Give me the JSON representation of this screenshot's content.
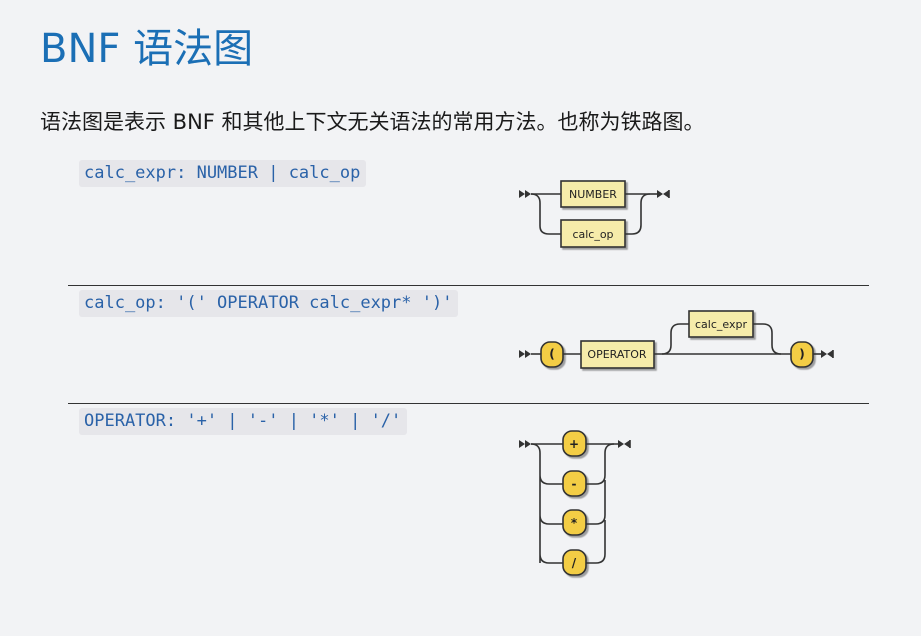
{
  "page": {
    "title": "BNF 语法图",
    "intro": "语法图是表示 BNF 和其他上下文无关语法的常用方法。也称为铁路图。"
  },
  "rules": [
    {
      "code": "calc_expr: NUMBER | calc_op",
      "diagram": {
        "choices": [
          "NUMBER",
          "calc_op"
        ]
      }
    },
    {
      "code": "calc_op: '(' OPERATOR calc_expr* ')'",
      "diagram": {
        "open": "(",
        "nonterminal": "OPERATOR",
        "repeat": "calc_expr",
        "close": ")"
      }
    },
    {
      "code": "OPERATOR: '+' | '-' | '*' | '/'",
      "diagram": {
        "choices": [
          "+",
          "-",
          "*",
          "/"
        ]
      }
    }
  ],
  "colors": {
    "title": "#1b6fb5",
    "code_text": "#2a62a8",
    "code_bg": "#e6e6ea",
    "box_fill": "#f6ecaa",
    "terminal_fill": "#f3cd45",
    "stroke": "#333333"
  }
}
